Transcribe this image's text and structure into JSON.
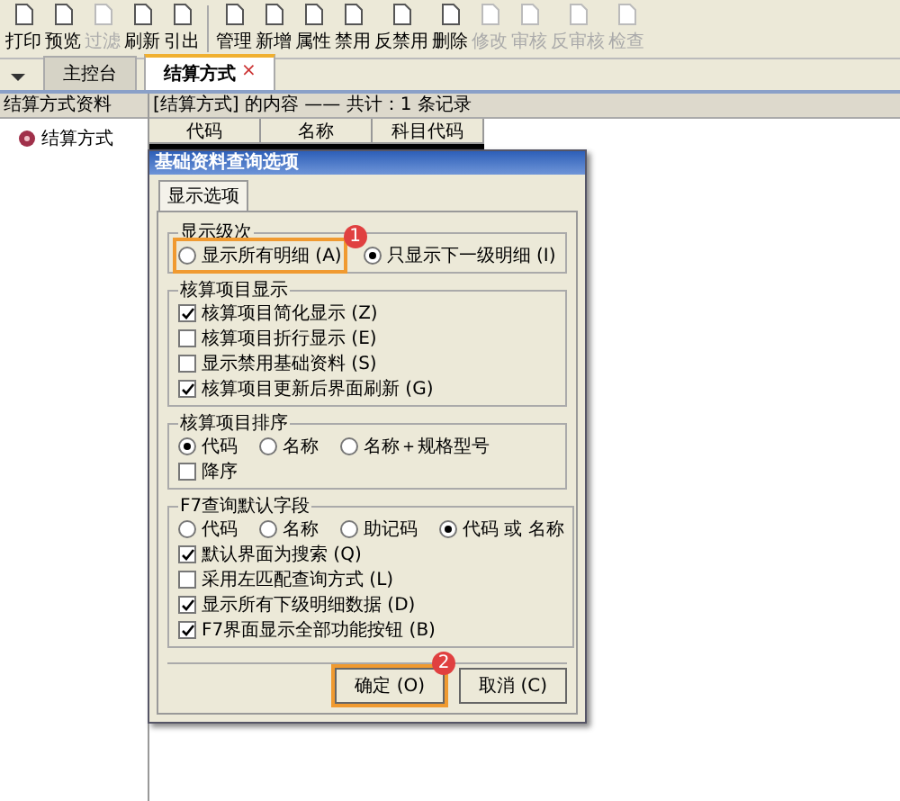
{
  "toolbar": [
    {
      "label": "打印",
      "disabled": false
    },
    {
      "label": "预览",
      "disabled": false
    },
    {
      "label": "过滤",
      "disabled": true
    },
    {
      "label": "刷新",
      "disabled": false
    },
    {
      "label": "引出",
      "disabled": false
    },
    {
      "label": "管理",
      "disabled": false
    },
    {
      "label": "新增",
      "disabled": false
    },
    {
      "label": "属性",
      "disabled": false
    },
    {
      "label": "禁用",
      "disabled": false
    },
    {
      "label": "反禁用",
      "disabled": false
    },
    {
      "label": "删除",
      "disabled": false
    },
    {
      "label": "修改",
      "disabled": true
    },
    {
      "label": "审核",
      "disabled": true
    },
    {
      "label": "反审核",
      "disabled": true
    },
    {
      "label": "检查",
      "disabled": true
    }
  ],
  "tabs": [
    {
      "label": "主控台",
      "selected": false
    },
    {
      "label": "结算方式",
      "selected": true
    }
  ],
  "tab_close": "×",
  "left_panel": {
    "title": "结算方式资料",
    "tree_item": "结算方式"
  },
  "content": {
    "title": "[结算方式] 的内容 —— 共计：1 条记录",
    "columns": [
      "代码",
      "名称",
      "科目代码"
    ]
  },
  "dialog": {
    "title": "基础资料查询选项",
    "tab": "显示选项",
    "groups": [
      {
        "title": "显示级次",
        "items": [
          {
            "kind": "radio",
            "label": "显示所有明细 (A)",
            "selected": false,
            "highlighted": true
          },
          {
            "kind": "radio",
            "label": "只显示下一级明细 (I)",
            "selected": true,
            "highlighted": false
          }
        ]
      },
      {
        "title": "核算项目显示",
        "items": [
          {
            "kind": "checkbox",
            "label": "核算项目简化显示 (Z)",
            "checked": true
          },
          {
            "kind": "checkbox",
            "label": "核算项目折行显示 (E)",
            "checked": false
          },
          {
            "kind": "checkbox",
            "label": "显示禁用基础资料 (S)",
            "checked": false
          },
          {
            "kind": "checkbox",
            "label": "核算项目更新后界面刷新 (G)",
            "checked": true
          }
        ]
      },
      {
        "title": "核算项目排序",
        "items": [
          {
            "kind": "radio",
            "label": "代码",
            "selected": true
          },
          {
            "kind": "radio",
            "label": "名称",
            "selected": false
          },
          {
            "kind": "radio",
            "label": "名称＋规格型号",
            "selected": false
          },
          {
            "kind": "checkbox",
            "label": "降序",
            "checked": false
          }
        ]
      },
      {
        "title": "F7查询默认字段",
        "items": [
          {
            "kind": "radio",
            "label": "代码",
            "selected": false
          },
          {
            "kind": "radio",
            "label": "名称",
            "selected": false
          },
          {
            "kind": "radio",
            "label": "助记码",
            "selected": false
          },
          {
            "kind": "radio",
            "label": "代码 或 名称",
            "selected": true
          },
          {
            "kind": "checkbox",
            "label": "默认界面为搜索 (Q)",
            "checked": true
          },
          {
            "kind": "checkbox",
            "label": "采用左匹配查询方式 (L)",
            "checked": false
          },
          {
            "kind": "checkbox",
            "label": "显示所有下级明细数据 (D)",
            "checked": true
          },
          {
            "kind": "checkbox",
            "label": "F7界面显示全部功能按钮 (B)",
            "checked": true
          }
        ]
      }
    ],
    "buttons": [
      {
        "label": "确定 (O)",
        "highlighted": true
      },
      {
        "label": "取消 (C)",
        "highlighted": false
      }
    ],
    "badges": [
      "1",
      "2"
    ]
  }
}
